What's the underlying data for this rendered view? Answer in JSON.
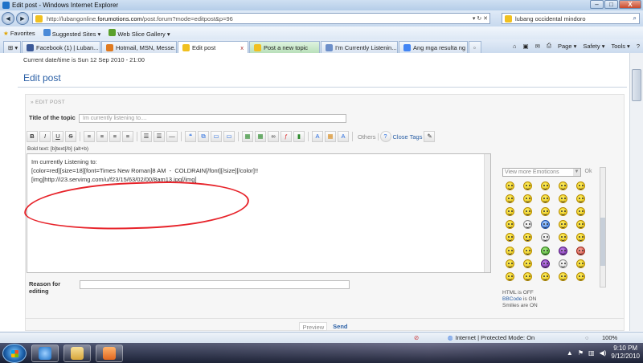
{
  "window": {
    "title": "Edit post - Windows Internet Explorer",
    "min": "–",
    "max": "□",
    "close": "X"
  },
  "nav": {
    "back": "◄",
    "fwd": "►"
  },
  "address": {
    "prefix": "http://lubangonline.",
    "domain": "forumotions.com",
    "path": "/post.forum?mode=editpost&p=96",
    "arrows": "▾ ↻ ✕"
  },
  "search": {
    "value": "lubang occidental mindoro",
    "icon": "⌕"
  },
  "favorites": {
    "label": "Favorites",
    "suggested": "Suggested Sites ▾",
    "webslice": "Web Slice Gallery ▾"
  },
  "tabs": [
    {
      "label": "Facebook (1) | Luban...",
      "color": "#3b5998"
    },
    {
      "label": "Hotmail, MSN, Messe...",
      "color": "#e07a1f"
    },
    {
      "label": "Edit post",
      "color": "#f0c020"
    },
    {
      "label": "Post a new topic",
      "color": "#f0c020"
    },
    {
      "label": "I'm Currently Listenin...",
      "color": "#6d8fc9"
    },
    {
      "label": "Ang mga resulta ng G...",
      "color": "#4285f4"
    }
  ],
  "commands": {
    "page": "Page ▾",
    "safety": "Safety ▾",
    "tools": "Tools ▾",
    "help": "?"
  },
  "page": {
    "datetime": "Current date/time is Sun 12 Sep 2010 - 21:00",
    "heading": "Edit post",
    "panel_head": "» EDIT POST",
    "title_label": "Title of the topic",
    "title_value": "Im currently listening to....",
    "bold_hint": "Bold text: [b]text[/b] (alt+b)",
    "editor_lines": [
      "Im currently Listening to:",
      "",
      "[color=red][size=18][font=Times New Roman]8 AM  -  COLDRAIN[/font][/size][/color]!!",
      "",
      "",
      "[img]http://i23.servimg.com/u/f23/15/63/02/00/8am13.jpg[/img]"
    ],
    "reason_label": "Reason for editing",
    "emoticons_select": "View more Emoticons",
    "emoticons_ok": "Ok",
    "html_status": "HTML is OFF",
    "bbcode_link": "BBCode",
    "bbcode_status": "is ON",
    "smilies_status": "Smilies are ON",
    "preview": "Preview",
    "send": "Send"
  },
  "toolbar": {
    "b": "B",
    "i": "I",
    "u": "U",
    "s": "S",
    "others": "Others",
    "close_tags": "Close Tags"
  },
  "status": {
    "zone": "Internet | Protected Mode: On",
    "zoom": "100%"
  },
  "tray": {
    "time": "9:10 PM",
    "date": "9/12/2010"
  }
}
